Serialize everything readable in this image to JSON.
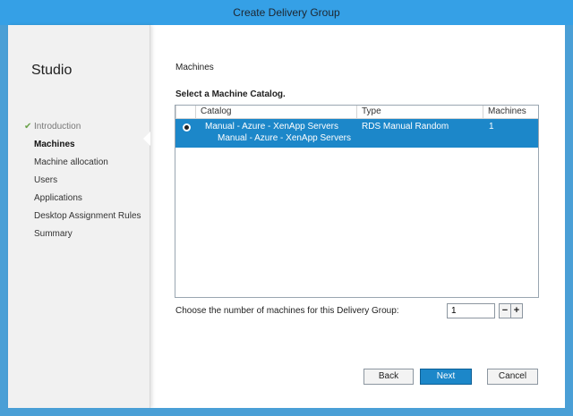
{
  "window": {
    "title": "Create Delivery Group"
  },
  "sidebar": {
    "brand": "Studio",
    "steps": [
      {
        "label": "Introduction",
        "state": "done",
        "check": "✔"
      },
      {
        "label": "Machines",
        "state": "active"
      },
      {
        "label": "Machine allocation",
        "state": "pending"
      },
      {
        "label": "Users",
        "state": "pending"
      },
      {
        "label": "Applications",
        "state": "pending"
      },
      {
        "label": "Desktop Assignment Rules",
        "state": "pending"
      },
      {
        "label": "Summary",
        "state": "pending"
      }
    ]
  },
  "main": {
    "section_title": "Machines",
    "prompt": "Select a Machine Catalog.",
    "table": {
      "columns": [
        "Catalog",
        "Type",
        "Machines"
      ],
      "rows": [
        {
          "catalog": "Manual - Azure - XenApp Servers",
          "description": "Manual - Azure - XenApp Servers",
          "type": "RDS Manual Random",
          "machines": "1",
          "selected": true
        }
      ]
    },
    "count_label": "Choose the number of machines for this Delivery Group:",
    "count_value": "1",
    "decrement": "−",
    "increment": "+"
  },
  "buttons": {
    "back": "Back",
    "next": "Next",
    "cancel": "Cancel"
  },
  "colors": {
    "accent": "#1c87c9",
    "frame": "#4a9fd6",
    "check": "#6aa24a"
  },
  "icons": {
    "step_done": "check-icon",
    "selection": "radio-selected-icon"
  }
}
